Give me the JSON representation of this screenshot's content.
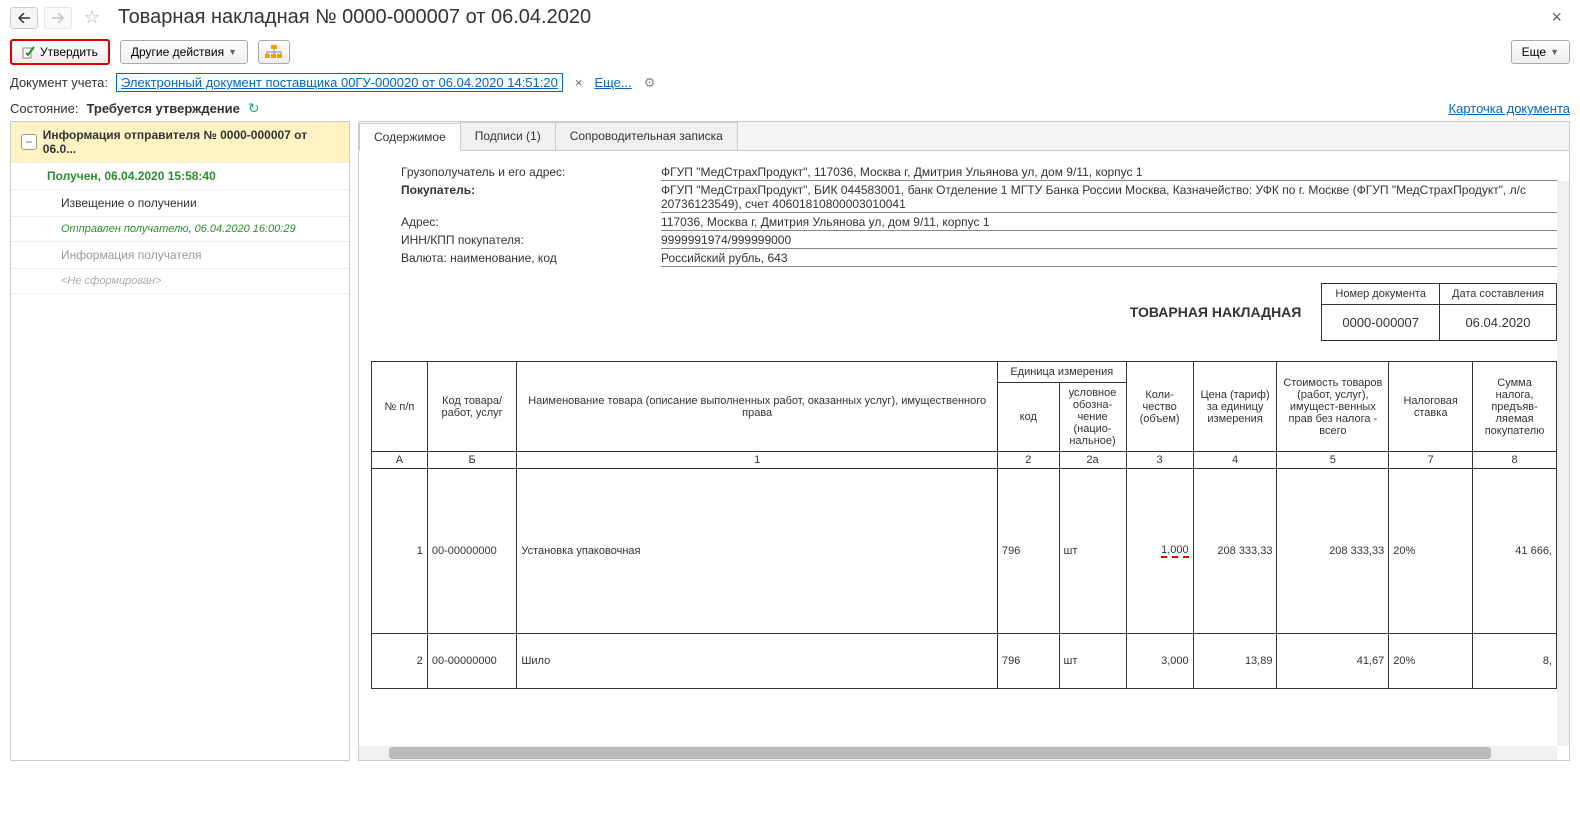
{
  "header": {
    "title": "Товарная накладная № 0000-000007 от 06.04.2020"
  },
  "actions": {
    "approve": "Утвердить",
    "other": "Другие действия",
    "more": "Еще"
  },
  "docline": {
    "label": "Документ учета:",
    "link": "Электронный документ поставщика 00ГУ-000020 от 06.04.2020 14:51:20",
    "more": "Еще..."
  },
  "state": {
    "label": "Состояние:",
    "value": "Требуется утверждение"
  },
  "cardlink": "Карточка документа",
  "sidebar": {
    "sender": "Информация отправителя № 0000-000007 от 06.0...",
    "received": "Получен, 06.04.2020 15:58:40",
    "notice": "Извещение о получении",
    "sent": "Отправлен получателю, 06.04.2020 16:00:29",
    "recipient": "Информация получателя",
    "notformed": "<Не сформирован>"
  },
  "tabs": {
    "content": "Содержимое",
    "signs": "Подписи (1)",
    "note": "Сопроводительная записка"
  },
  "fields": {
    "consignee_lbl": "Грузополучатель и его адрес:",
    "consignee_val": "ФГУП \"МедСтрахПродукт\", 117036, Москва г, Дмитрия Ульянова ул, дом 9/11, корпус 1",
    "buyer_lbl": "Покупатель:",
    "buyer_val": "ФГУП \"МедСтрахПродукт\", БИК 044583001, банк Отделение 1 МГТУ Банка России Москва, Казначейство: УФК по г. Москве (ФГУП \"МедСтрахПродукт\", л/с 20736123549), счет 40601810800003010041",
    "addr_lbl": "Адрес:",
    "addr_val": "117036, Москва г, Дмитрия Ульянова ул, дом 9/11, корпус 1",
    "inn_lbl": "ИНН/КПП покупателя:",
    "inn_val": "9999991974/999999000",
    "curr_lbl": "Валюта: наименование, код",
    "curr_val": "Российский рубль, 643"
  },
  "docbox": {
    "title": "ТОВАРНАЯ НАКЛАДНАЯ",
    "num_lbl": "Номер документа",
    "num_val": "0000-000007",
    "date_lbl": "Дата составления",
    "date_val": "06.04.2020"
  },
  "table": {
    "h1": "№ п/п",
    "h2": "Код товара/ работ, услуг",
    "h3": "Наименование товара (описание выполненных работ, оказанных услуг), имущественного права",
    "h_unit": "Единица измерения",
    "h4a": "код",
    "h4b": "условное обозна-чение (нацио-нальное)",
    "h5": "Коли-чество (объем)",
    "h6": "Цена (тариф) за единицу измерения",
    "h7": "Стоимость товаров (работ, услуг), имущест-венных прав без налога - всего",
    "h8": "Налоговая ставка",
    "h9": "Сумма налога, предъяв-ляемая покупателю",
    "colA": "А",
    "colB": "Б",
    "col1": "1",
    "col2": "2",
    "col2a": "2а",
    "col3": "3",
    "col4": "4",
    "col5": "5",
    "col7": "7",
    "col8": "8",
    "rows": [
      {
        "n": "1",
        "code": "00-00000000",
        "name": "Установка упаковочная",
        "ucode": "796",
        "uname": "шт",
        "qty": "1,000",
        "price": "208 333,33",
        "sum": "208 333,33",
        "rate": "20%",
        "tax": "41 666,"
      },
      {
        "n": "2",
        "code": "00-00000000",
        "name": "Шило",
        "ucode": "796",
        "uname": "шт",
        "qty": "3,000",
        "price": "13,89",
        "sum": "41,67",
        "rate": "20%",
        "tax": "8,"
      }
    ]
  }
}
